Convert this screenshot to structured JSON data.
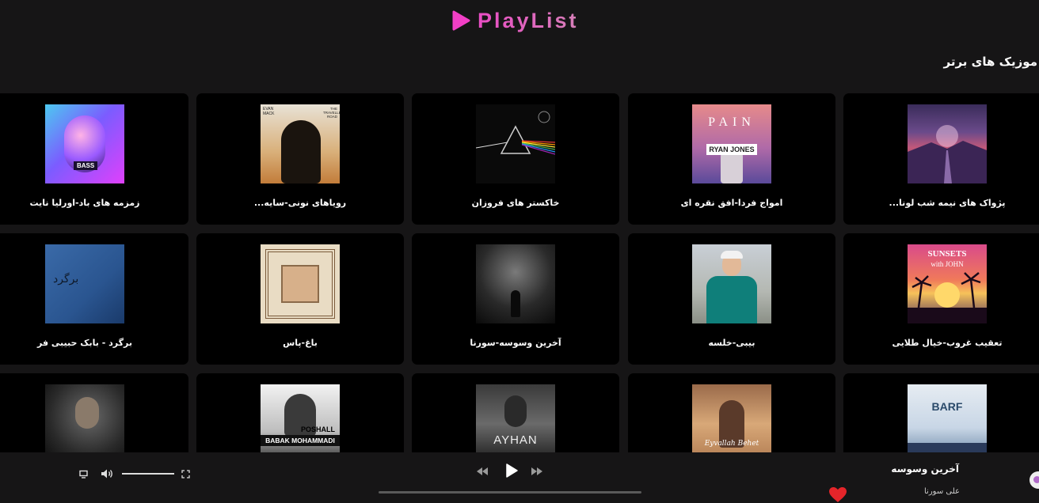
{
  "app": {
    "logo_text": "PlayList",
    "brand_color": "#e63ec0"
  },
  "section": {
    "title": "موزیک های برتر"
  },
  "tracks": [
    {
      "title": "پژواک های نیمه شب لونا..."
    },
    {
      "title": "امواج فردا-افق نقره ای"
    },
    {
      "title": "خاکستر های فروزان"
    },
    {
      "title": "رویاهای نونی-سایه..."
    },
    {
      "title": "زمزمه های باد-اورلیا نایت"
    },
    {
      "title": "تعقیب غروب-خیال طلایی"
    },
    {
      "title": "بیبی-خلسه"
    },
    {
      "title": "آخرین وسوسه-سورنا"
    },
    {
      "title": "باغ-پاس"
    },
    {
      "title": "برگرد - بابک حبیبی فر"
    },
    {
      "title": ""
    },
    {
      "title": ""
    },
    {
      "title": ""
    },
    {
      "title": ""
    },
    {
      "title": ""
    }
  ],
  "covers": [
    {
      "icon": "sphere-album-cover"
    },
    {
      "icon": "pain-ryan-jones-album-cover",
      "text": "PAIN",
      "subtext": "RYAN JONES"
    },
    {
      "icon": "prism-album-cover"
    },
    {
      "icon": "travelled-road-album-cover",
      "text": "THE TRAVELLED ROAD",
      "subtext": "EVAN MACK"
    },
    {
      "icon": "bass-album-cover",
      "text": "BASS"
    },
    {
      "icon": "sunsets-with-john-album-cover",
      "text": "SUNSETS",
      "subtext": "with JOHN"
    },
    {
      "icon": "artist-photo-cover"
    },
    {
      "icon": "dark-forest-cover"
    },
    {
      "icon": "persian-pattern-cover"
    },
    {
      "icon": "bargard-cover",
      "text": "برگرد"
    },
    {
      "icon": "barf-cover",
      "text": "BARF"
    },
    {
      "icon": "eyvallah-behet-cover",
      "text": "Eyvallah Behet"
    },
    {
      "icon": "ayhan-cover",
      "text": "AYHAN"
    },
    {
      "icon": "poshall-babak-mohammadi-cover",
      "text": "POSHALL",
      "subtext": "BABAK MOHAMMADI"
    },
    {
      "icon": "portrait-cover"
    }
  ],
  "player": {
    "now_playing_title": "آخرین وسوسه",
    "now_playing_artist": "علی سورنا",
    "volume": 1.0,
    "progress": 0.0
  }
}
